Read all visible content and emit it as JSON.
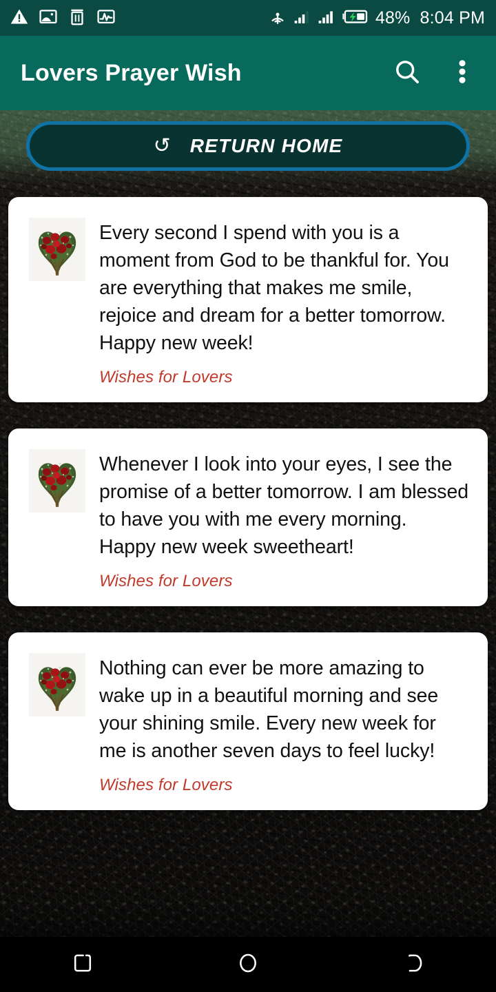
{
  "status_bar": {
    "background": "#0a4a43",
    "left_icons": [
      {
        "name": "warning-icon",
        "glyph": "warning"
      },
      {
        "name": "screenshot-image-icon",
        "glyph": "image"
      },
      {
        "name": "trash-icon",
        "glyph": "trash"
      },
      {
        "name": "activity-pulse-icon",
        "glyph": "pulse"
      }
    ],
    "right_icons": [
      {
        "name": "hotspot-cast-icon",
        "glyph": "cast"
      },
      {
        "name": "signal-bars-sim1-icon",
        "glyph": "signal"
      },
      {
        "name": "signal-bars-sim2-icon",
        "glyph": "signal"
      },
      {
        "name": "battery-charging-icon",
        "glyph": "battery"
      }
    ],
    "battery_percent": "48%",
    "time": "8:04 PM"
  },
  "app_bar": {
    "title": "Lovers Prayer Wish",
    "background": "#086a5c",
    "search_label": "Search",
    "overflow_label": "More options"
  },
  "return_home": {
    "label": "RETURN HOME",
    "icon": "refresh-icon",
    "icon_glyph": "↺",
    "border_color": "#1073a5",
    "fill_color": "#083330",
    "text_color": "#ffffff"
  },
  "theme": {
    "accent_teal": "#086a5c",
    "accent_blue": "#1073a5",
    "attribution_red": "#c0392b",
    "card_background": "#ffffff",
    "page_background": "#141210"
  },
  "cards": [
    {
      "thumbnail": "heart-rose-bouquet-image",
      "message": "Every second I spend with you is a moment from God to be thankful for. You are everything that makes me smile, rejoice and dream for a better tomorrow. Happy new week!",
      "attribution": "Wishes for Lovers"
    },
    {
      "thumbnail": "heart-rose-bouquet-image",
      "message": "Whenever I look into your eyes, I see the promise of a better tomorrow. I am blessed to have you with me every morning. Happy new week sweetheart!",
      "attribution": "Wishes for Lovers"
    },
    {
      "thumbnail": "heart-rose-bouquet-image",
      "message": "Nothing can ever be more amazing to wake up in a beautiful morning and see your shining smile. Every new week for me is another seven days to feel lucky!",
      "attribution": "Wishes for Lovers"
    }
  ],
  "nav_bar": {
    "background": "#000000",
    "buttons": [
      {
        "name": "recents-button",
        "label": "Recent apps"
      },
      {
        "name": "home-button",
        "label": "Home"
      },
      {
        "name": "back-button",
        "label": "Back"
      }
    ]
  }
}
